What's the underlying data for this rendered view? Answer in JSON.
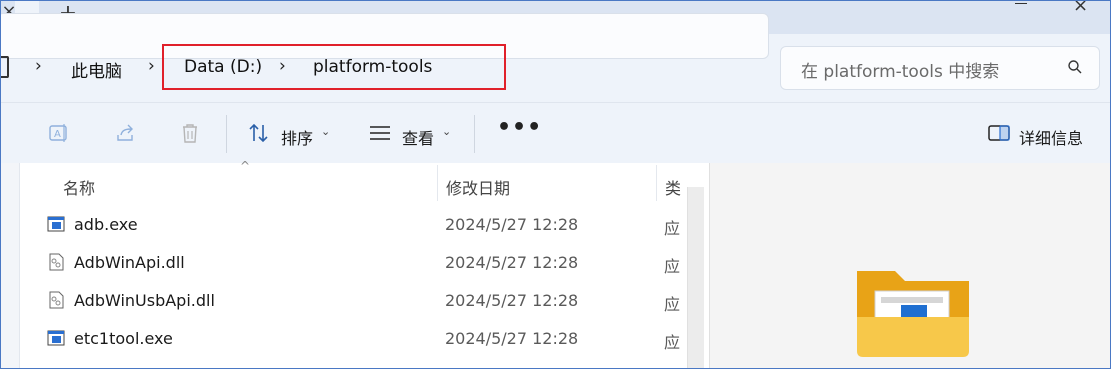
{
  "tabs": {
    "close_glyph": "×",
    "new_tab_glyph": "+"
  },
  "breadcrumb": {
    "items": [
      "此电脑",
      "Data (D:)",
      "platform-tools"
    ],
    "separator": "›"
  },
  "search": {
    "placeholder": "在 platform-tools 中搜索"
  },
  "toolbar": {
    "sort_label": "排序",
    "view_label": "查看",
    "more_label": "•••",
    "details_label": "详细信息"
  },
  "columns": {
    "name": "名称",
    "date": "修改日期",
    "type": "类"
  },
  "files": [
    {
      "name": "adb.exe",
      "date": "2024/5/27 12:28",
      "type": "应",
      "icon": "exe-icon"
    },
    {
      "name": "AdbWinApi.dll",
      "date": "2024/5/27 12:28",
      "type": "应",
      "icon": "dll-icon"
    },
    {
      "name": "AdbWinUsbApi.dll",
      "date": "2024/5/27 12:28",
      "type": "应",
      "icon": "dll-icon"
    },
    {
      "name": "etc1tool.exe",
      "date": "2024/5/27 12:28",
      "type": "应",
      "icon": "exe-icon"
    }
  ],
  "colors": {
    "highlight": "#e0202a",
    "accent": "#2a6fd1",
    "chrome": "#eef3fa"
  }
}
